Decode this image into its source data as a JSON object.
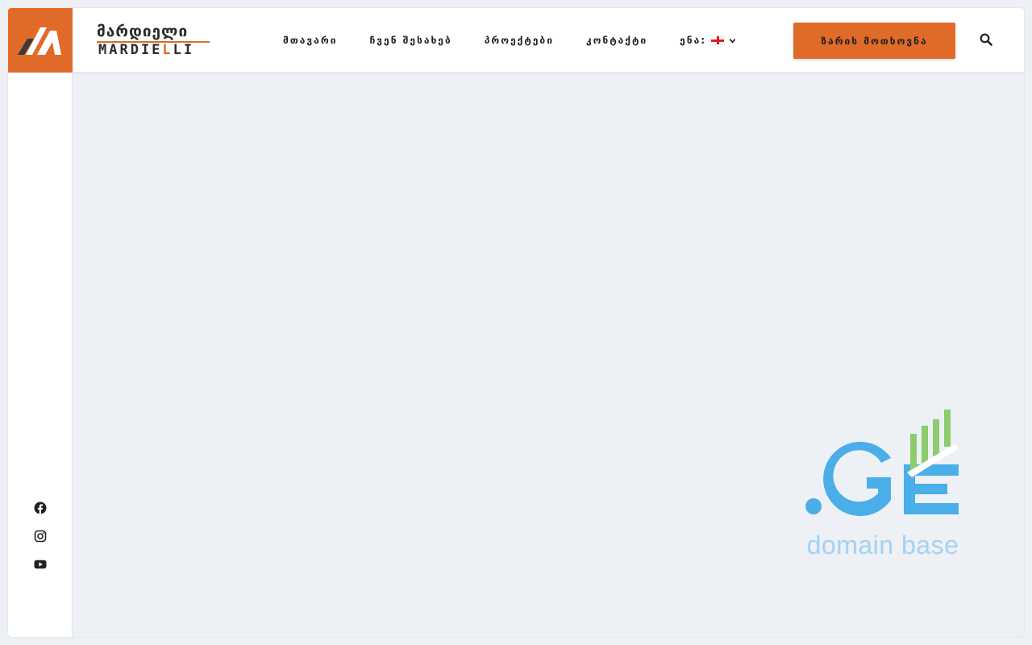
{
  "brand": {
    "name_geo": "მარდიელი",
    "name_lat_pre": "MARDIE",
    "name_lat_accent": "L",
    "name_lat_post": "LI",
    "accent_color": "#e06a28"
  },
  "nav": {
    "items": [
      {
        "label": "მთავარი"
      },
      {
        "label": "ჩვენ შესახებ"
      },
      {
        "label": "პროექტები"
      },
      {
        "label": "კონტაქტი"
      }
    ],
    "language_label": "ენა:",
    "language_flag_icon": "georgia-flag-icon",
    "chevron_icon": "chevron-down-icon"
  },
  "header": {
    "cta_label": "ზარის მოთხოვნა",
    "search_icon": "search-icon"
  },
  "sidebar": {
    "socials": [
      {
        "icon": "facebook-icon"
      },
      {
        "icon": "instagram-icon"
      },
      {
        "icon": "youtube-icon"
      }
    ]
  },
  "watermark": {
    "brand_text": ".GE",
    "caption": "domain base",
    "blue": "#4aaee8",
    "green": "#8ccc6e"
  }
}
